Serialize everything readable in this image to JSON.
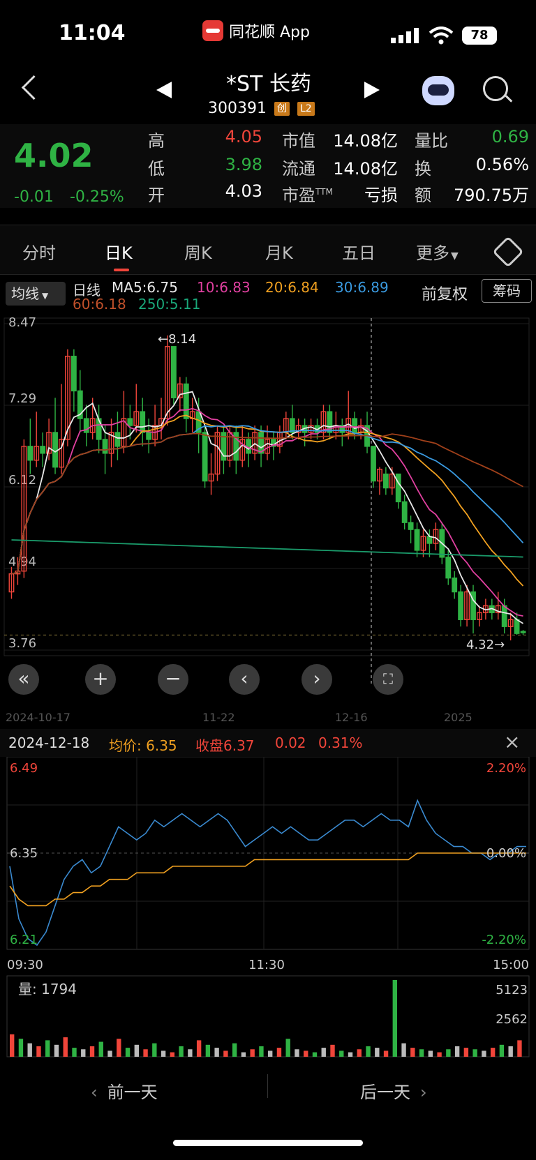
{
  "status_bar": {
    "time": "11:04",
    "app": "同花顺 App",
    "battery": "78"
  },
  "header": {
    "name": "*ST 长药",
    "code": "300391",
    "tag1": "创",
    "tag2": "L2"
  },
  "quote": {
    "price": "4.02",
    "change": "-0.01",
    "change_pct": "-0.25%",
    "high_label": "高",
    "high": "4.05",
    "low_label": "低",
    "low": "3.98",
    "open_label": "开",
    "open": "4.03",
    "mcap_label": "市值",
    "mcap": "14.08亿",
    "float_label": "流通",
    "float": "14.08亿",
    "pe_label": "市盈",
    "pe_sup": "TTM",
    "pe": "亏损",
    "vr_label": "量比",
    "vr": "0.69",
    "turn_label": "换",
    "turn": "0.56%",
    "amount_label": "额",
    "amount": "790.75万"
  },
  "tabs": [
    "分时",
    "日K",
    "周K",
    "月K",
    "五日",
    "更多"
  ],
  "ma_bar": {
    "select": "均线",
    "period": "日线",
    "ma5": "MA5:6.75",
    "ma10": "10:6.83",
    "ma20": "20:6.84",
    "ma30": "30:6.89",
    "ma60": "60:6.18",
    "ma250": "250:5.11",
    "restore": "前复权",
    "chips": "筹码"
  },
  "colors": {
    "up": "#f0453a",
    "down": "#2fb344",
    "ma5": "#e8e8e8",
    "ma10": "#e040a0",
    "ma20": "#f0a020",
    "ma30": "#3a9ae0",
    "ma60": "#a0401a",
    "ma250": "#1a9a6a",
    "avg": "#f0a020",
    "price": "#3a8ad0"
  },
  "kline": {
    "ylabels": [
      "8.47",
      "7.29",
      "6.12",
      "4.94",
      "3.76"
    ],
    "max_label": "←8.14",
    "min_label": "4.32→",
    "xlabels": [
      "2024-10-17",
      "11-22",
      "12-16",
      "2025"
    ],
    "candles": [
      [
        4.6,
        4.86,
        4.5,
        4.96
      ],
      [
        4.86,
        4.9,
        4.7,
        5.1
      ],
      [
        4.9,
        6.7,
        4.8,
        6.8
      ],
      [
        6.7,
        6.5,
        6.3,
        7.1
      ],
      [
        6.5,
        6.7,
        6.4,
        7.2
      ],
      [
        6.7,
        6.6,
        6.4,
        6.9
      ],
      [
        6.6,
        6.9,
        6.5,
        7.1
      ],
      [
        6.9,
        6.4,
        6.3,
        7.4
      ],
      [
        6.4,
        6.8,
        6.3,
        7.6
      ],
      [
        6.8,
        8.0,
        6.7,
        8.1
      ],
      [
        8.0,
        7.5,
        7.2,
        8.1
      ],
      [
        7.5,
        7.1,
        6.9,
        7.8
      ],
      [
        7.1,
        6.9,
        6.7,
        7.3
      ],
      [
        6.9,
        7.1,
        6.8,
        7.4
      ],
      [
        7.1,
        6.8,
        6.6,
        7.3
      ],
      [
        6.8,
        6.6,
        6.3,
        7.0
      ],
      [
        6.6,
        6.9,
        6.4,
        7.1
      ],
      [
        6.9,
        6.7,
        6.5,
        7.2
      ],
      [
        6.7,
        7.1,
        6.6,
        7.5
      ],
      [
        7.1,
        7.0,
        6.8,
        7.3
      ],
      [
        7.0,
        7.2,
        6.9,
        7.6
      ],
      [
        7.2,
        6.9,
        6.7,
        7.4
      ],
      [
        6.9,
        6.8,
        6.6,
        7.1
      ],
      [
        6.8,
        7.0,
        6.7,
        7.3
      ],
      [
        7.0,
        7.1,
        6.8,
        7.4
      ],
      [
        7.1,
        8.14,
        7.0,
        8.3
      ],
      [
        8.14,
        7.4,
        7.3,
        8.14
      ],
      [
        7.4,
        7.6,
        7.2,
        7.7
      ],
      [
        7.6,
        7.1,
        6.9,
        7.7
      ],
      [
        7.1,
        7.2,
        6.9,
        7.4
      ],
      [
        7.2,
        6.9,
        6.6,
        7.4
      ],
      [
        6.9,
        6.2,
        6.1,
        7.0
      ],
      [
        6.2,
        6.3,
        6.0,
        6.6
      ],
      [
        6.3,
        6.9,
        6.2,
        7.0
      ],
      [
        6.9,
        6.5,
        6.3,
        7.0
      ],
      [
        6.5,
        6.9,
        6.4,
        7.0
      ],
      [
        6.9,
        6.5,
        6.3,
        7.0
      ],
      [
        6.5,
        6.8,
        6.4,
        7.0
      ],
      [
        6.8,
        6.6,
        6.4,
        6.9
      ],
      [
        6.6,
        6.9,
        6.5,
        7.0
      ],
      [
        6.9,
        6.6,
        6.4,
        7.0
      ],
      [
        6.6,
        6.8,
        6.5,
        7.0
      ],
      [
        6.8,
        6.7,
        6.5,
        6.9
      ],
      [
        6.7,
        6.9,
        6.6,
        7.0
      ],
      [
        6.9,
        7.1,
        6.8,
        7.2
      ],
      [
        7.1,
        6.9,
        6.8,
        7.3
      ],
      [
        6.9,
        7.0,
        6.8,
        7.1
      ],
      [
        7.0,
        6.9,
        6.7,
        7.1
      ],
      [
        6.9,
        7.0,
        6.8,
        7.1
      ],
      [
        7.0,
        6.9,
        6.8,
        7.1
      ],
      [
        6.9,
        7.2,
        6.8,
        7.3
      ],
      [
        7.2,
        6.9,
        6.8,
        7.3
      ],
      [
        6.9,
        7.0,
        6.8,
        7.2
      ],
      [
        7.0,
        6.9,
        6.7,
        7.1
      ],
      [
        6.9,
        7.1,
        6.8,
        7.5
      ],
      [
        7.1,
        6.9,
        6.8,
        7.2
      ],
      [
        6.9,
        7.0,
        6.8,
        7.1
      ],
      [
        7.0,
        6.7,
        6.6,
        7.2
      ],
      [
        6.7,
        6.2,
        6.1,
        6.7
      ],
      [
        6.2,
        6.37,
        6.0,
        6.4
      ],
      [
        6.3,
        6.1,
        6.0,
        6.4
      ],
      [
        6.1,
        6.3,
        6.0,
        6.4
      ],
      [
        6.3,
        5.9,
        5.8,
        6.3
      ],
      [
        5.9,
        5.6,
        5.5,
        6.0
      ],
      [
        5.6,
        5.5,
        5.3,
        5.7
      ],
      [
        5.5,
        5.2,
        5.1,
        5.6
      ],
      [
        5.2,
        5.4,
        5.1,
        5.5
      ],
      [
        5.4,
        5.3,
        5.1,
        5.5
      ],
      [
        5.3,
        5.5,
        5.2,
        5.6
      ],
      [
        5.5,
        5.1,
        5.0,
        5.6
      ],
      [
        5.1,
        4.8,
        4.7,
        5.2
      ],
      [
        4.8,
        4.6,
        4.5,
        4.9
      ],
      [
        4.6,
        4.2,
        4.1,
        4.7
      ],
      [
        4.2,
        4.6,
        4.1,
        4.7
      ],
      [
        4.6,
        4.2,
        4.0,
        4.7
      ],
      [
        4.2,
        4.3,
        4.1,
        4.4
      ],
      [
        4.3,
        4.4,
        4.2,
        4.5
      ],
      [
        4.4,
        4.3,
        4.2,
        4.5
      ],
      [
        4.3,
        4.4,
        4.2,
        4.6
      ],
      [
        4.4,
        4.1,
        4.0,
        4.5
      ],
      [
        4.1,
        4.2,
        3.9,
        4.3
      ],
      [
        4.2,
        4.0,
        3.98,
        4.3
      ],
      [
        4.03,
        4.02,
        3.98,
        4.05
      ]
    ]
  },
  "intraday": {
    "date": "2024-12-18",
    "avg_label": "均价:",
    "avg": "6.35",
    "close_label": "收盘",
    "close": "6.37",
    "chg": "0.02",
    "chg_pct": "0.31%",
    "ytop": "6.49",
    "ymid": "6.35",
    "ybot": "6.21",
    "pct_top": "2.20%",
    "pct_mid": "0.00%",
    "pct_bot": "-2.20%",
    "t_start": "09:30",
    "t_mid": "11:30",
    "t_end": "15:00",
    "price_series": [
      6.33,
      6.25,
      6.22,
      6.21,
      6.23,
      6.27,
      6.31,
      6.33,
      6.34,
      6.32,
      6.33,
      6.36,
      6.39,
      6.38,
      6.37,
      6.38,
      6.4,
      6.39,
      6.4,
      6.41,
      6.4,
      6.39,
      6.4,
      6.41,
      6.4,
      6.38,
      6.36,
      6.37,
      6.38,
      6.39,
      6.38,
      6.39,
      6.38,
      6.37,
      6.37,
      6.38,
      6.39,
      6.4,
      6.4,
      6.39,
      6.4,
      6.41,
      6.4,
      6.4,
      6.39,
      6.43,
      6.4,
      6.38,
      6.37,
      6.36,
      6.36,
      6.35,
      6.35,
      6.34,
      6.35,
      6.35,
      6.36,
      6.36
    ],
    "avg_series": [
      6.3,
      6.28,
      6.27,
      6.27,
      6.27,
      6.28,
      6.28,
      6.29,
      6.29,
      6.3,
      6.3,
      6.31,
      6.31,
      6.31,
      6.32,
      6.32,
      6.32,
      6.32,
      6.33,
      6.33,
      6.33,
      6.33,
      6.33,
      6.33,
      6.33,
      6.33,
      6.33,
      6.34,
      6.34,
      6.34,
      6.34,
      6.34,
      6.34,
      6.34,
      6.34,
      6.34,
      6.34,
      6.34,
      6.34,
      6.34,
      6.34,
      6.34,
      6.34,
      6.34,
      6.34,
      6.35,
      6.35,
      6.35,
      6.35,
      6.35,
      6.35,
      6.35,
      6.35,
      6.35,
      6.35,
      6.35,
      6.35,
      6.35
    ]
  },
  "volume": {
    "label": "量:",
    "value": "1794",
    "y1": "5123",
    "y2": "2562",
    "bars": [
      1500,
      1200,
      900,
      700,
      1100,
      800,
      1300,
      600,
      500,
      700,
      1000,
      400,
      1200,
      600,
      800,
      500,
      900,
      400,
      300,
      700,
      500,
      1100,
      800,
      600,
      400,
      900,
      300,
      500,
      700,
      400,
      600,
      1200,
      500,
      400,
      300,
      600,
      800,
      400,
      300,
      500,
      700,
      600,
      400,
      5123,
      900,
      600,
      500,
      400,
      300,
      500,
      700,
      600,
      500,
      400,
      600,
      800,
      700,
      1100
    ]
  },
  "footer": {
    "prev": "前一天",
    "next": "后一天"
  }
}
